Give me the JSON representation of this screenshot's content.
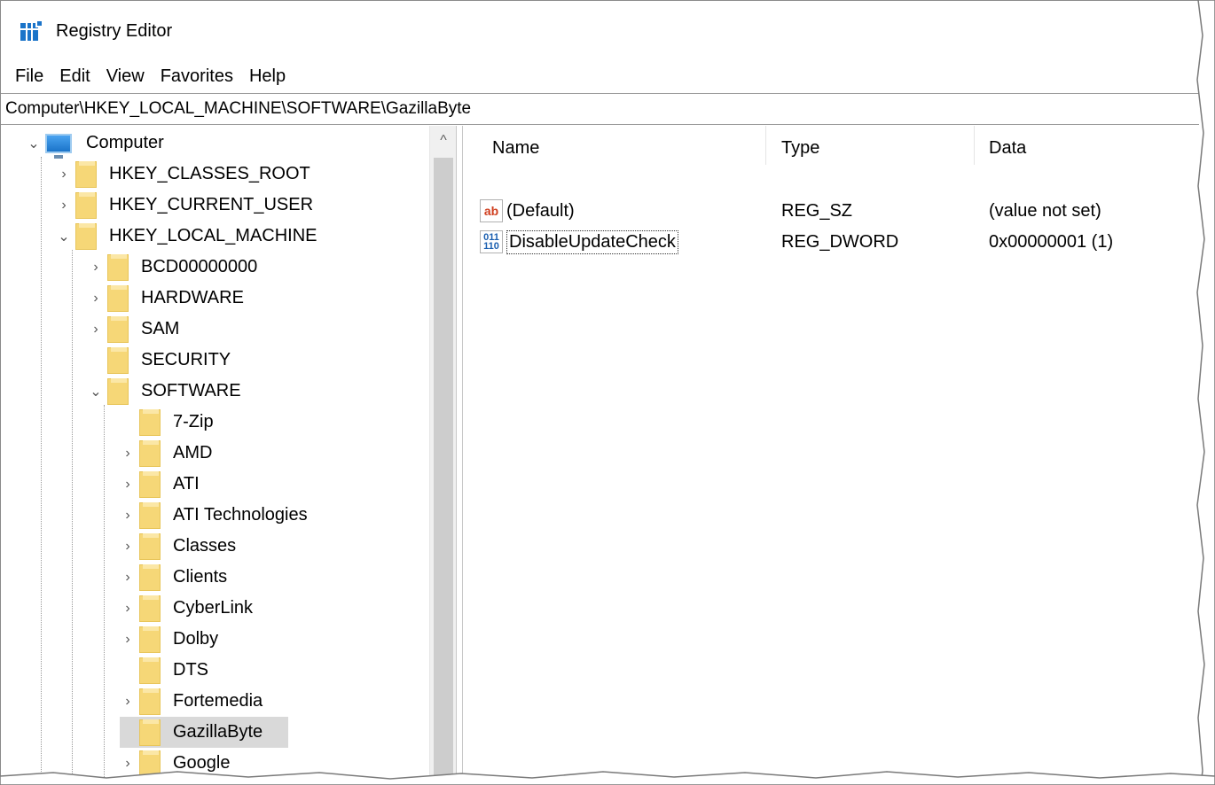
{
  "window": {
    "title": "Registry Editor"
  },
  "menu": [
    "File",
    "Edit",
    "View",
    "Favorites",
    "Help"
  ],
  "address": "Computer\\HKEY_LOCAL_MACHINE\\SOFTWARE\\GazillaByte",
  "tree": {
    "root": "Computer",
    "hives": [
      "HKEY_CLASSES_ROOT",
      "HKEY_CURRENT_USER",
      "HKEY_LOCAL_MACHINE"
    ],
    "hklm_children": [
      "BCD00000000",
      "HARDWARE",
      "SAM",
      "SECURITY",
      "SOFTWARE"
    ],
    "software_children": [
      "7-Zip",
      "AMD",
      "ATI",
      "ATI Technologies",
      "Classes",
      "Clients",
      "CyberLink",
      "Dolby",
      "DTS",
      "Fortemedia",
      "GazillaByte",
      "Google"
    ],
    "selected": "GazillaByte"
  },
  "list": {
    "headers": {
      "name": "Name",
      "type": "Type",
      "data": "Data"
    },
    "rows": [
      {
        "name": "(Default)",
        "type": "REG_SZ",
        "data": "(value not set)",
        "icon": "string-value-icon"
      },
      {
        "name": "DisableUpdateCheck",
        "type": "REG_DWORD",
        "data": "0x00000001 (1)",
        "icon": "dword-value-icon"
      }
    ]
  },
  "icons": {
    "string_glyph": "ab",
    "dword_glyph": "011\n110",
    "expand_collapsed": "›",
    "expand_open": "⌄",
    "scroll_up": "^"
  }
}
